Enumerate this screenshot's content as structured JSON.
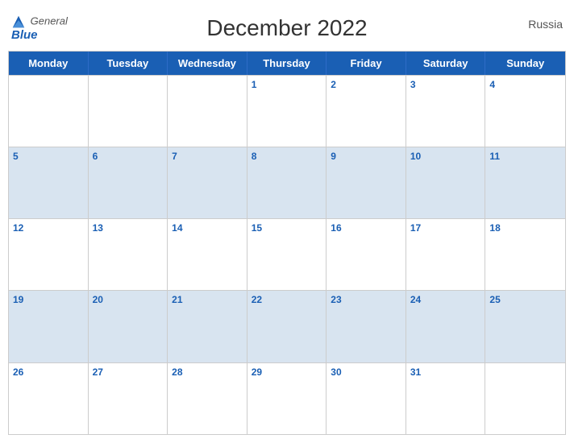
{
  "header": {
    "logo": {
      "general": "General",
      "blue": "Blue"
    },
    "title": "December 2022",
    "country": "Russia"
  },
  "days_of_week": [
    "Monday",
    "Tuesday",
    "Wednesday",
    "Thursday",
    "Friday",
    "Saturday",
    "Sunday"
  ],
  "weeks": [
    [
      {
        "date": "",
        "empty": true
      },
      {
        "date": "",
        "empty": true
      },
      {
        "date": "",
        "empty": true
      },
      {
        "date": "1",
        "empty": false
      },
      {
        "date": "2",
        "empty": false
      },
      {
        "date": "3",
        "empty": false
      },
      {
        "date": "4",
        "empty": false
      }
    ],
    [
      {
        "date": "5",
        "empty": false
      },
      {
        "date": "6",
        "empty": false
      },
      {
        "date": "7",
        "empty": false
      },
      {
        "date": "8",
        "empty": false
      },
      {
        "date": "9",
        "empty": false
      },
      {
        "date": "10",
        "empty": false
      },
      {
        "date": "11",
        "empty": false
      }
    ],
    [
      {
        "date": "12",
        "empty": false
      },
      {
        "date": "13",
        "empty": false
      },
      {
        "date": "14",
        "empty": false
      },
      {
        "date": "15",
        "empty": false
      },
      {
        "date": "16",
        "empty": false
      },
      {
        "date": "17",
        "empty": false
      },
      {
        "date": "18",
        "empty": false
      }
    ],
    [
      {
        "date": "19",
        "empty": false
      },
      {
        "date": "20",
        "empty": false
      },
      {
        "date": "21",
        "empty": false
      },
      {
        "date": "22",
        "empty": false
      },
      {
        "date": "23",
        "empty": false
      },
      {
        "date": "24",
        "empty": false
      },
      {
        "date": "25",
        "empty": false
      }
    ],
    [
      {
        "date": "26",
        "empty": false
      },
      {
        "date": "27",
        "empty": false
      },
      {
        "date": "28",
        "empty": false
      },
      {
        "date": "29",
        "empty": false
      },
      {
        "date": "30",
        "empty": false
      },
      {
        "date": "31",
        "empty": false
      },
      {
        "date": "",
        "empty": true
      }
    ]
  ]
}
